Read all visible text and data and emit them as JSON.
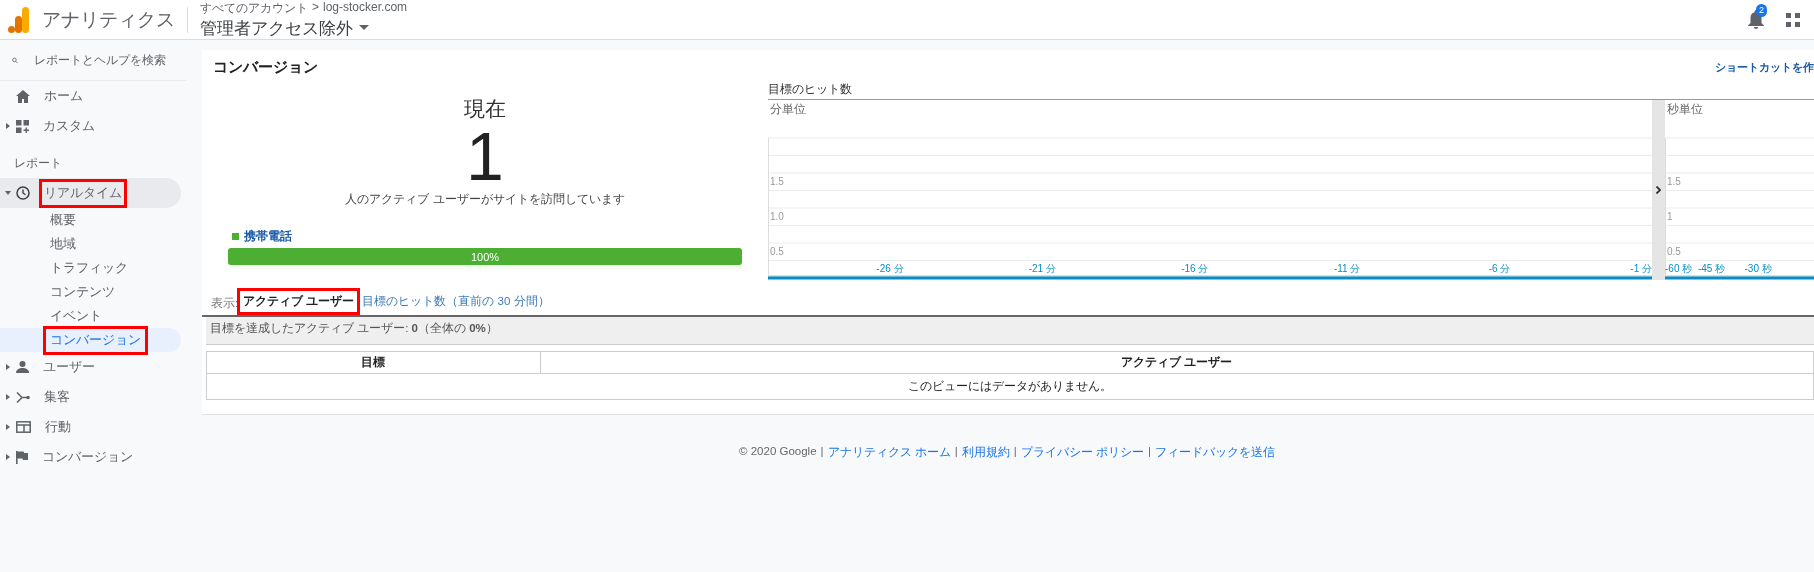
{
  "header": {
    "app_name": "アナリティクス",
    "breadcrumb": [
      "すべてのアカウント",
      "log-stocker.com"
    ],
    "breadcrumb_separator": ">",
    "view": "管理者アクセス除外",
    "notification_count": "2"
  },
  "sidebar": {
    "search_placeholder": "レポートとヘルプを検索",
    "home": {
      "label": "ホーム"
    },
    "groups": [
      {
        "label": "カスタム",
        "expanded": false
      }
    ],
    "section": "レポート",
    "reports": [
      {
        "label": "リアルタイム",
        "expanded": true,
        "highlighted": true,
        "children": [
          {
            "label": "概要",
            "selected": false,
            "highlighted": false
          },
          {
            "label": "地域",
            "selected": false,
            "highlighted": false
          },
          {
            "label": "トラフィック",
            "selected": false,
            "highlighted": false
          },
          {
            "label": "コンテンツ",
            "selected": false,
            "highlighted": false
          },
          {
            "label": "イベント",
            "selected": false,
            "highlighted": false
          },
          {
            "label": "コンバージョン",
            "selected": true,
            "highlighted": true
          }
        ]
      },
      {
        "label": "ユーザー",
        "expanded": false,
        "highlighted": false
      },
      {
        "label": "集客",
        "expanded": false,
        "highlighted": false
      },
      {
        "label": "行動",
        "expanded": false,
        "highlighted": false
      },
      {
        "label": "コンバージョン",
        "expanded": false,
        "highlighted": false
      }
    ]
  },
  "page": {
    "title": "コンバージョン",
    "shortcut_link": "ショートカットを作",
    "now": {
      "label": "現在",
      "count": "1",
      "caption": "人のアクティブ ユーザーがサイトを訪問しています"
    },
    "devices": [
      {
        "label": "携帯電話",
        "level": 1,
        "reading": "100%"
      }
    ],
    "hits": {
      "title": "目標のヒット数",
      "charts": [
        {
          "chart_data": {
            "type": "line",
            "title": "分単位",
            "x": [
              -30,
              -29,
              -28,
              -27,
              -26,
              -25,
              -24,
              -23,
              -22,
              -21,
              -20,
              -19,
              -18,
              -17,
              -16,
              -15,
              -14,
              -13,
              -12,
              -11,
              -10,
              -9,
              -8,
              -7,
              -6,
              -5,
              -4,
              -3,
              -2,
              -1
            ],
            "series": [
              {
                "color": "#058dc7",
                "values": [
                  0,
                  0,
                  0,
                  0,
                  0,
                  0,
                  0,
                  0,
                  0,
                  0,
                  0,
                  0,
                  0,
                  0,
                  0,
                  0,
                  0,
                  0,
                  0,
                  0,
                  0,
                  0,
                  0,
                  0,
                  0,
                  0,
                  0,
                  0,
                  0,
                  0
                ]
              }
            ],
            "xlim": [
              -30,
              -1
            ],
            "ylim": [
              0,
              2
            ],
            "grid": true,
            "xticks": [
              {
                "value": -26,
                "label": "-26 分"
              },
              {
                "value": -21,
                "label": "-21 分"
              },
              {
                "value": -16,
                "label": "-16 分"
              },
              {
                "value": -11,
                "label": "-11 分"
              },
              {
                "value": -6,
                "label": "-6 分"
              },
              {
                "value": -1,
                "label": "-1 分"
              }
            ],
            "yticks": [
              {
                "value": 0.5,
                "label": "0.5"
              },
              {
                "value": 1,
                "label": "1.0"
              },
              {
                "value": 1.5,
                "label": "1.5"
              }
            ]
          }
        },
        {
          "chart_data": {
            "type": "line",
            "title": "秒単位",
            "x": [
              -60,
              -56,
              -52,
              -48,
              -44,
              -40,
              -36,
              -32,
              -28,
              -24,
              -20,
              -16,
              -12
            ],
            "series": [
              {
                "color": "#058dc7",
                "values": [
                  0,
                  0,
                  0,
                  0,
                  0,
                  0,
                  0,
                  0,
                  0,
                  0,
                  0,
                  0,
                  0
                ]
              }
            ],
            "xlim": [
              -60,
              -12
            ],
            "ylim": [
              0,
              2
            ],
            "grid": true,
            "xticks": [
              {
                "value": -60,
                "label": "-60 秒"
              },
              {
                "value": -45,
                "label": "-45 秒"
              },
              {
                "value": -30,
                "label": "-30 秒"
              }
            ],
            "yticks": [
              {
                "value": 0.5,
                "label": "0.5"
              },
              {
                "value": 1,
                "label": "1"
              },
              {
                "value": 1.5,
                "label": "1.5"
              }
            ]
          }
        }
      ]
    },
    "view_label": "表示:",
    "tabs": [
      {
        "label": "アクティブ ユーザー",
        "selected": true,
        "highlighted": true
      },
      {
        "label": "目標のヒット数（直前の 30 分間）",
        "selected": false,
        "highlighted": false
      }
    ],
    "summary": "目標を達成したアクティブ ユーザー: **0**（全体の **0%**）",
    "table": {
      "columns": [
        "目標",
        "アクティブ ユーザー"
      ],
      "empty_message": "このビューにはデータがありません。"
    }
  },
  "footer": {
    "copyright": "© 2020 Google",
    "links": [
      "アナリティクス ホーム",
      "利用規約",
      "プライバシー ポリシー",
      "フィードバックを送信"
    ],
    "separator": "|"
  }
}
